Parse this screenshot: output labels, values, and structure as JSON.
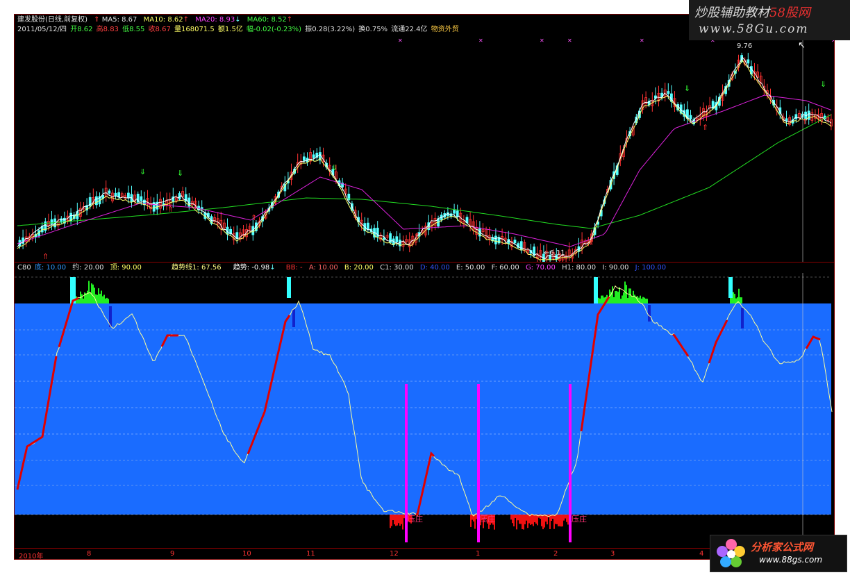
{
  "header1": {
    "stock": "建发股份(日线,前复权)",
    "ma5": "MA5: 8.67",
    "ma10": "MA10: 8.62",
    "ma20": "MA20: 8.93",
    "ma60": "MA60: 8.52"
  },
  "header2": {
    "date": "2011/05/12/四",
    "open": "开8.62",
    "high": "高8.83",
    "low": "低8.55",
    "close": "收8.67",
    "volume": "量168071.5",
    "amount": "额1.5亿",
    "change": "幅-0.02(-0.23%)",
    "amplitude": "振0.28(3.22%)",
    "turnover": "换0.75%",
    "float": "流通22.4亿",
    "sector": "物资外贸"
  },
  "price_chart": {
    "high_label": "9.76",
    "low_label": "←6.11"
  },
  "indicator_header": {
    "name": "C80",
    "low": "底: 10.00",
    "about": "约: 20.00",
    "top": "顶: 90.00",
    "trend_line": "趋势线1: 67.56",
    "trend": "趋势: -0.98",
    "bb": "BB: -",
    "a": "A: 10.00",
    "b": "B: 20.00",
    "c1": "C1: 30.00",
    "d": "D: 40.00",
    "e": "E: 50.00",
    "f": "F: 60.00",
    "g": "G: 70.00",
    "h1": "H1: 80.00",
    "i": "I: 90.00",
    "j": "J: 100.00"
  },
  "signals": {
    "z1": "压庄",
    "z2": "压庄",
    "z3": "压庄"
  },
  "time_axis": [
    "2010年",
    "8",
    "9",
    "10",
    "11",
    "12",
    "1",
    "2",
    "3",
    "4"
  ],
  "watermark_top": {
    "line1_a": "炒股辅助教材",
    "line1_b": "58股网",
    "line2": "www.58Gu.com"
  },
  "watermark_bottom": {
    "line1": "分析家公式网",
    "line2": "www.88gs.com"
  },
  "colors": {
    "bg": "#000000",
    "up": "#ff3232",
    "down": "#54ffff",
    "ma5": "#ffffff",
    "ma10": "#ffff00",
    "ma20": "#ff00ff",
    "ma60": "#00ff00",
    "fill": "#1a6cff",
    "trend_up": "#e00000",
    "trend_line": "#ffff80",
    "peak": "#00e000",
    "signal": "#ff00ff"
  }
}
